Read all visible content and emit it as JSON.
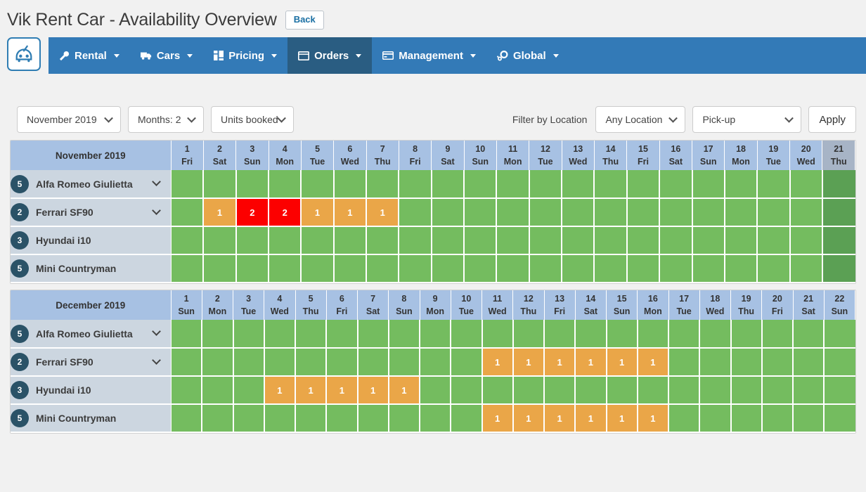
{
  "header": {
    "title": "Vik Rent Car - Availability Overview",
    "back_label": "Back"
  },
  "nav": {
    "logo_name": "vik-rent-car-logo",
    "items": [
      {
        "label": "Rental",
        "icon": "wrench-icon",
        "active": false,
        "caret": true
      },
      {
        "label": "Cars",
        "icon": "truck-icon",
        "active": false,
        "caret": true
      },
      {
        "label": "Pricing",
        "icon": "grid-icon",
        "active": false,
        "caret": true
      },
      {
        "label": "Orders",
        "icon": "window-icon",
        "active": true,
        "caret": true
      },
      {
        "label": "Management",
        "icon": "credit-card-icon",
        "active": false,
        "caret": true
      },
      {
        "label": "Global",
        "icon": "gear-icon",
        "active": false,
        "caret": true
      }
    ]
  },
  "filters": {
    "month": "November 2019",
    "months_count": "Months: 2",
    "mode": "Units booked",
    "location_label": "Filter by Location",
    "location": "Any Location",
    "pickup": "Pick-up",
    "apply_label": "Apply"
  },
  "legend_colors": {
    "free": "#74bc5f",
    "free_highlight": "#5ba054",
    "partial": "#eaa648",
    "full": "#fc0000",
    "header": "#a7c1e3",
    "header_highlight": "#a7b4c6",
    "vehicle_row": "#ccd6e0",
    "badge": "#2a5267",
    "navbar": "#337ab7",
    "nav_active": "#2a5d82"
  },
  "calendars": [
    {
      "month_label": "November 2019",
      "highlight_day": 21,
      "days": [
        {
          "num": "1",
          "wd": "Fri"
        },
        {
          "num": "2",
          "wd": "Sat"
        },
        {
          "num": "3",
          "wd": "Sun"
        },
        {
          "num": "4",
          "wd": "Mon"
        },
        {
          "num": "5",
          "wd": "Tue"
        },
        {
          "num": "6",
          "wd": "Wed"
        },
        {
          "num": "7",
          "wd": "Thu"
        },
        {
          "num": "8",
          "wd": "Fri"
        },
        {
          "num": "9",
          "wd": "Sat"
        },
        {
          "num": "10",
          "wd": "Sun"
        },
        {
          "num": "11",
          "wd": "Mon"
        },
        {
          "num": "12",
          "wd": "Tue"
        },
        {
          "num": "13",
          "wd": "Wed"
        },
        {
          "num": "14",
          "wd": "Thu"
        },
        {
          "num": "15",
          "wd": "Fri"
        },
        {
          "num": "16",
          "wd": "Sat"
        },
        {
          "num": "17",
          "wd": "Sun"
        },
        {
          "num": "18",
          "wd": "Mon"
        },
        {
          "num": "19",
          "wd": "Tue"
        },
        {
          "num": "20",
          "wd": "Wed"
        },
        {
          "num": "21",
          "wd": "Thu"
        }
      ],
      "rows": [
        {
          "units": "5",
          "name": "Alfa Romeo Giulietta",
          "expandable": true,
          "cells": [
            {
              "s": "free",
              "v": ""
            },
            {
              "s": "free",
              "v": ""
            },
            {
              "s": "free",
              "v": ""
            },
            {
              "s": "free",
              "v": ""
            },
            {
              "s": "free",
              "v": ""
            },
            {
              "s": "free",
              "v": ""
            },
            {
              "s": "free",
              "v": ""
            },
            {
              "s": "free",
              "v": ""
            },
            {
              "s": "free",
              "v": ""
            },
            {
              "s": "free",
              "v": ""
            },
            {
              "s": "free",
              "v": ""
            },
            {
              "s": "free",
              "v": ""
            },
            {
              "s": "free",
              "v": ""
            },
            {
              "s": "free",
              "v": ""
            },
            {
              "s": "free",
              "v": ""
            },
            {
              "s": "free",
              "v": ""
            },
            {
              "s": "free",
              "v": ""
            },
            {
              "s": "free",
              "v": ""
            },
            {
              "s": "free",
              "v": ""
            },
            {
              "s": "free",
              "v": ""
            },
            {
              "s": "free",
              "v": ""
            }
          ]
        },
        {
          "units": "2",
          "name": "Ferrari SF90",
          "expandable": true,
          "cells": [
            {
              "s": "free",
              "v": ""
            },
            {
              "s": "part",
              "v": "1"
            },
            {
              "s": "full",
              "v": "2"
            },
            {
              "s": "full",
              "v": "2"
            },
            {
              "s": "part",
              "v": "1"
            },
            {
              "s": "part",
              "v": "1"
            },
            {
              "s": "part",
              "v": "1"
            },
            {
              "s": "free",
              "v": ""
            },
            {
              "s": "free",
              "v": ""
            },
            {
              "s": "free",
              "v": ""
            },
            {
              "s": "free",
              "v": ""
            },
            {
              "s": "free",
              "v": ""
            },
            {
              "s": "free",
              "v": ""
            },
            {
              "s": "free",
              "v": ""
            },
            {
              "s": "free",
              "v": ""
            },
            {
              "s": "free",
              "v": ""
            },
            {
              "s": "free",
              "v": ""
            },
            {
              "s": "free",
              "v": ""
            },
            {
              "s": "free",
              "v": ""
            },
            {
              "s": "free",
              "v": ""
            },
            {
              "s": "free",
              "v": ""
            }
          ]
        },
        {
          "units": "3",
          "name": "Hyundai i10",
          "expandable": false,
          "cells": [
            {
              "s": "free",
              "v": ""
            },
            {
              "s": "free",
              "v": ""
            },
            {
              "s": "free",
              "v": ""
            },
            {
              "s": "free",
              "v": ""
            },
            {
              "s": "free",
              "v": ""
            },
            {
              "s": "free",
              "v": ""
            },
            {
              "s": "free",
              "v": ""
            },
            {
              "s": "free",
              "v": ""
            },
            {
              "s": "free",
              "v": ""
            },
            {
              "s": "free",
              "v": ""
            },
            {
              "s": "free",
              "v": ""
            },
            {
              "s": "free",
              "v": ""
            },
            {
              "s": "free",
              "v": ""
            },
            {
              "s": "free",
              "v": ""
            },
            {
              "s": "free",
              "v": ""
            },
            {
              "s": "free",
              "v": ""
            },
            {
              "s": "free",
              "v": ""
            },
            {
              "s": "free",
              "v": ""
            },
            {
              "s": "free",
              "v": ""
            },
            {
              "s": "free",
              "v": ""
            },
            {
              "s": "free",
              "v": ""
            }
          ]
        },
        {
          "units": "5",
          "name": "Mini Countryman",
          "expandable": false,
          "cells": [
            {
              "s": "free",
              "v": ""
            },
            {
              "s": "free",
              "v": ""
            },
            {
              "s": "free",
              "v": ""
            },
            {
              "s": "free",
              "v": ""
            },
            {
              "s": "free",
              "v": ""
            },
            {
              "s": "free",
              "v": ""
            },
            {
              "s": "free",
              "v": ""
            },
            {
              "s": "free",
              "v": ""
            },
            {
              "s": "free",
              "v": ""
            },
            {
              "s": "free",
              "v": ""
            },
            {
              "s": "free",
              "v": ""
            },
            {
              "s": "free",
              "v": ""
            },
            {
              "s": "free",
              "v": ""
            },
            {
              "s": "free",
              "v": ""
            },
            {
              "s": "free",
              "v": ""
            },
            {
              "s": "free",
              "v": ""
            },
            {
              "s": "free",
              "v": ""
            },
            {
              "s": "free",
              "v": ""
            },
            {
              "s": "free",
              "v": ""
            },
            {
              "s": "free",
              "v": ""
            },
            {
              "s": "free",
              "v": ""
            }
          ]
        }
      ]
    },
    {
      "month_label": "December 2019",
      "highlight_day": 0,
      "days": [
        {
          "num": "1",
          "wd": "Sun"
        },
        {
          "num": "2",
          "wd": "Mon"
        },
        {
          "num": "3",
          "wd": "Tue"
        },
        {
          "num": "4",
          "wd": "Wed"
        },
        {
          "num": "5",
          "wd": "Thu"
        },
        {
          "num": "6",
          "wd": "Fri"
        },
        {
          "num": "7",
          "wd": "Sat"
        },
        {
          "num": "8",
          "wd": "Sun"
        },
        {
          "num": "9",
          "wd": "Mon"
        },
        {
          "num": "10",
          "wd": "Tue"
        },
        {
          "num": "11",
          "wd": "Wed"
        },
        {
          "num": "12",
          "wd": "Thu"
        },
        {
          "num": "13",
          "wd": "Fri"
        },
        {
          "num": "14",
          "wd": "Sat"
        },
        {
          "num": "15",
          "wd": "Sun"
        },
        {
          "num": "16",
          "wd": "Mon"
        },
        {
          "num": "17",
          "wd": "Tue"
        },
        {
          "num": "18",
          "wd": "Wed"
        },
        {
          "num": "19",
          "wd": "Thu"
        },
        {
          "num": "20",
          "wd": "Fri"
        },
        {
          "num": "21",
          "wd": "Sat"
        },
        {
          "num": "22",
          "wd": "Sun"
        }
      ],
      "rows": [
        {
          "units": "5",
          "name": "Alfa Romeo Giulietta",
          "expandable": true,
          "cells": [
            {
              "s": "free",
              "v": ""
            },
            {
              "s": "free",
              "v": ""
            },
            {
              "s": "free",
              "v": ""
            },
            {
              "s": "free",
              "v": ""
            },
            {
              "s": "free",
              "v": ""
            },
            {
              "s": "free",
              "v": ""
            },
            {
              "s": "free",
              "v": ""
            },
            {
              "s": "free",
              "v": ""
            },
            {
              "s": "free",
              "v": ""
            },
            {
              "s": "free",
              "v": ""
            },
            {
              "s": "free",
              "v": ""
            },
            {
              "s": "free",
              "v": ""
            },
            {
              "s": "free",
              "v": ""
            },
            {
              "s": "free",
              "v": ""
            },
            {
              "s": "free",
              "v": ""
            },
            {
              "s": "free",
              "v": ""
            },
            {
              "s": "free",
              "v": ""
            },
            {
              "s": "free",
              "v": ""
            },
            {
              "s": "free",
              "v": ""
            },
            {
              "s": "free",
              "v": ""
            },
            {
              "s": "free",
              "v": ""
            },
            {
              "s": "free",
              "v": ""
            }
          ]
        },
        {
          "units": "2",
          "name": "Ferrari SF90",
          "expandable": true,
          "cells": [
            {
              "s": "free",
              "v": ""
            },
            {
              "s": "free",
              "v": ""
            },
            {
              "s": "free",
              "v": ""
            },
            {
              "s": "free",
              "v": ""
            },
            {
              "s": "free",
              "v": ""
            },
            {
              "s": "free",
              "v": ""
            },
            {
              "s": "free",
              "v": ""
            },
            {
              "s": "free",
              "v": ""
            },
            {
              "s": "free",
              "v": ""
            },
            {
              "s": "free",
              "v": ""
            },
            {
              "s": "part",
              "v": "1"
            },
            {
              "s": "part",
              "v": "1"
            },
            {
              "s": "part",
              "v": "1"
            },
            {
              "s": "part",
              "v": "1"
            },
            {
              "s": "part",
              "v": "1"
            },
            {
              "s": "part",
              "v": "1"
            },
            {
              "s": "free",
              "v": ""
            },
            {
              "s": "free",
              "v": ""
            },
            {
              "s": "free",
              "v": ""
            },
            {
              "s": "free",
              "v": ""
            },
            {
              "s": "free",
              "v": ""
            },
            {
              "s": "free",
              "v": ""
            }
          ]
        },
        {
          "units": "3",
          "name": "Hyundai i10",
          "expandable": false,
          "cells": [
            {
              "s": "free",
              "v": ""
            },
            {
              "s": "free",
              "v": ""
            },
            {
              "s": "free",
              "v": ""
            },
            {
              "s": "part",
              "v": "1"
            },
            {
              "s": "part",
              "v": "1"
            },
            {
              "s": "part",
              "v": "1"
            },
            {
              "s": "part",
              "v": "1"
            },
            {
              "s": "part",
              "v": "1"
            },
            {
              "s": "free",
              "v": ""
            },
            {
              "s": "free",
              "v": ""
            },
            {
              "s": "free",
              "v": ""
            },
            {
              "s": "free",
              "v": ""
            },
            {
              "s": "free",
              "v": ""
            },
            {
              "s": "free",
              "v": ""
            },
            {
              "s": "free",
              "v": ""
            },
            {
              "s": "free",
              "v": ""
            },
            {
              "s": "free",
              "v": ""
            },
            {
              "s": "free",
              "v": ""
            },
            {
              "s": "free",
              "v": ""
            },
            {
              "s": "free",
              "v": ""
            },
            {
              "s": "free",
              "v": ""
            },
            {
              "s": "free",
              "v": ""
            }
          ]
        },
        {
          "units": "5",
          "name": "Mini Countryman",
          "expandable": false,
          "cells": [
            {
              "s": "free",
              "v": ""
            },
            {
              "s": "free",
              "v": ""
            },
            {
              "s": "free",
              "v": ""
            },
            {
              "s": "free",
              "v": ""
            },
            {
              "s": "free",
              "v": ""
            },
            {
              "s": "free",
              "v": ""
            },
            {
              "s": "free",
              "v": ""
            },
            {
              "s": "free",
              "v": ""
            },
            {
              "s": "free",
              "v": ""
            },
            {
              "s": "free",
              "v": ""
            },
            {
              "s": "part",
              "v": "1"
            },
            {
              "s": "part",
              "v": "1"
            },
            {
              "s": "part",
              "v": "1"
            },
            {
              "s": "part",
              "v": "1"
            },
            {
              "s": "part",
              "v": "1"
            },
            {
              "s": "part",
              "v": "1"
            },
            {
              "s": "free",
              "v": ""
            },
            {
              "s": "free",
              "v": ""
            },
            {
              "s": "free",
              "v": ""
            },
            {
              "s": "free",
              "v": ""
            },
            {
              "s": "free",
              "v": ""
            },
            {
              "s": "free",
              "v": ""
            }
          ]
        }
      ]
    }
  ]
}
